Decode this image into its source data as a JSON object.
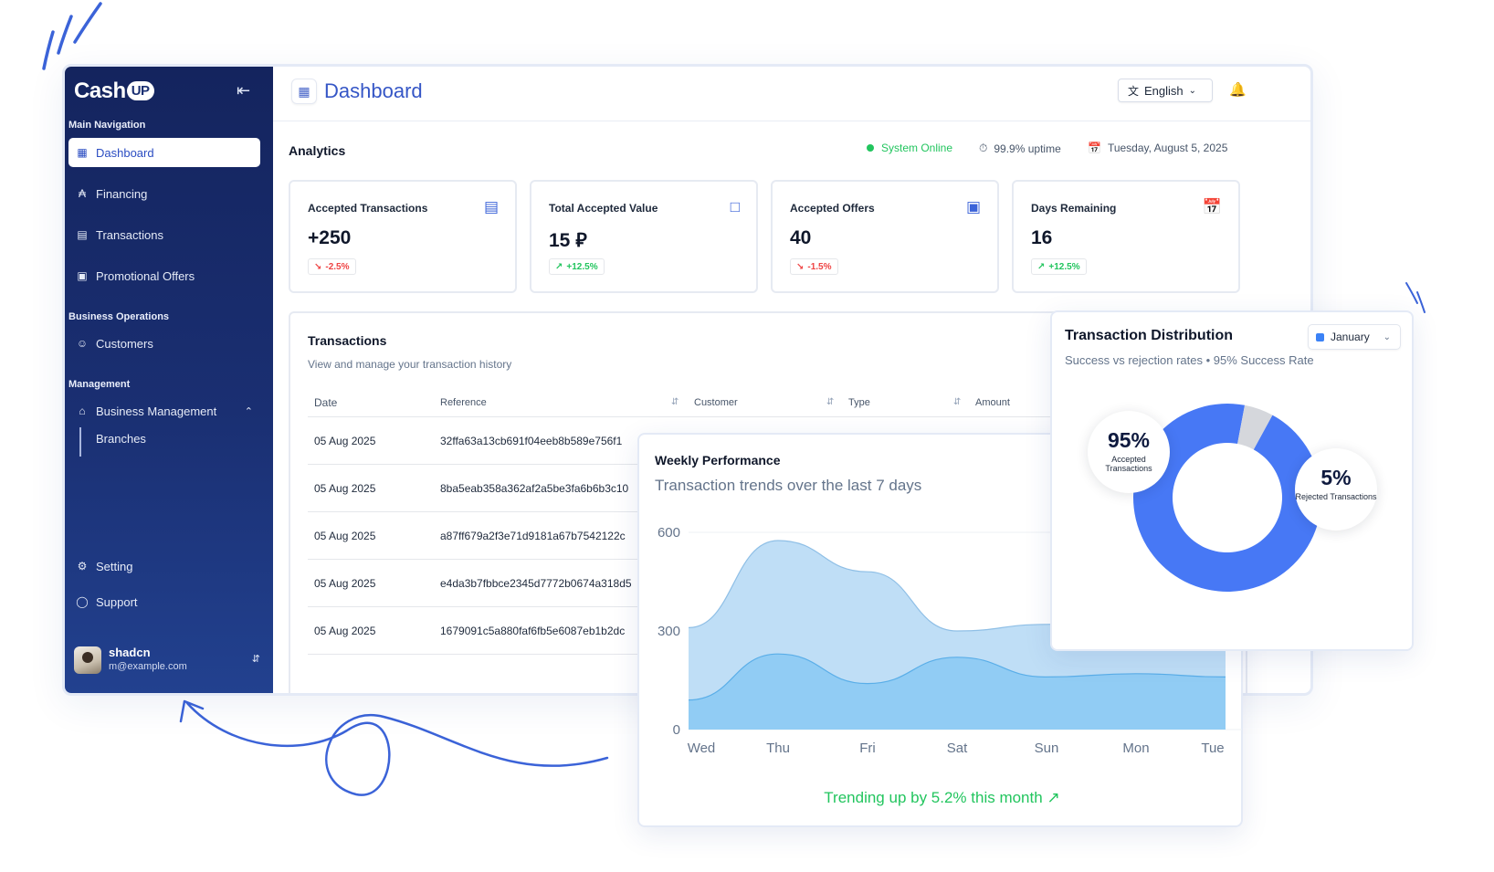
{
  "sidebar": {
    "logo": "Cash",
    "logo_badge": "UP",
    "main_nav_label": "Main Navigation",
    "business_ops_label": "Business Operations",
    "management_label": "Management",
    "items": {
      "dashboard": "Dashboard",
      "financing": "Financing",
      "transactions": "Transactions",
      "promotional_offers": "Promotional Offers",
      "customers": "Customers",
      "business_management": "Business Management",
      "branches": "Branches",
      "setting": "Setting",
      "support": "Support"
    },
    "user": {
      "name": "shadcn",
      "email": "m@example.com"
    }
  },
  "header": {
    "title": "Dashboard",
    "language": "English"
  },
  "analytics": {
    "title": "Analytics",
    "system_status": "System Online",
    "uptime": "99.9% uptime",
    "date": "Tuesday, August 5, 2025",
    "status_color": "#22c55e"
  },
  "stats": [
    {
      "label": "Accepted Transactions",
      "value": "+250",
      "change": "-2.5%",
      "trend": "down",
      "icon": "list-icon"
    },
    {
      "label": "Total Accepted Value",
      "value": "15 ⃁",
      "change": "+12.5%",
      "trend": "up",
      "icon": "wallet-icon"
    },
    {
      "label": "Accepted Offers",
      "value": "40",
      "change": "-1.5%",
      "trend": "down",
      "icon": "ticket-icon"
    },
    {
      "label": "Days Remaining",
      "value": "16",
      "change": "+12.5%",
      "trend": "up",
      "icon": "calendar-icon"
    }
  ],
  "transactions": {
    "title": "Transactions",
    "subtitle": "View and manage your transaction history",
    "columns": [
      "Date",
      "Reference",
      "Customer",
      "Type",
      "Amount"
    ],
    "rows": [
      {
        "date": "05 Aug 2025",
        "reference": "32ffa63a13cb691f04eeb8b589e756f1"
      },
      {
        "date": "05 Aug 2025",
        "reference": "8ba5eab358a362af2a5be3fa6b6b3c10"
      },
      {
        "date": "05 Aug 2025",
        "reference": "a87ff679a2f3e71d9181a67b7542122c"
      },
      {
        "date": "05 Aug 2025",
        "reference": "e4da3b7fbbce2345d7772b0674a318d5"
      },
      {
        "date": "05 Aug 2025",
        "reference": "1679091c5a880faf6fb5e6087eb1b2dc"
      }
    ]
  },
  "weekly": {
    "title": "Weekly Performance",
    "subtitle": "Transaction trends over the last 7 days",
    "footer": "Trending up by 5.2% this month",
    "footer_icon": "trending-up-icon"
  },
  "chart_data": [
    {
      "type": "area",
      "title": "Weekly Performance",
      "subtitle": "Transaction trends over the last 7 days",
      "categories": [
        "Wed",
        "Thu",
        "Fri",
        "Sat",
        "Sun",
        "Mon",
        "Tue"
      ],
      "yticks": [
        "600",
        "300",
        "0"
      ],
      "ylim": [
        0,
        600
      ],
      "grid": true,
      "series": [
        {
          "values": [
            310,
            575,
            480,
            300,
            320,
            360,
            390
          ],
          "color": "#bcdcf5"
        },
        {
          "values": [
            90,
            230,
            140,
            220,
            160,
            170,
            160
          ],
          "color": "#8ccaf4"
        }
      ]
    },
    {
      "type": "pie",
      "title": "Transaction Distribution",
      "subtitle": "Success vs rejection rates • 95% Success Rate",
      "filter": "January",
      "slices": [
        {
          "label": "Accepted Transactions",
          "value": 95,
          "display": "95%",
          "color": "#4778f5"
        },
        {
          "label": "Rejected Transactions",
          "value": 5,
          "display": "5%",
          "color": "#d5d7dc"
        }
      ]
    }
  ]
}
